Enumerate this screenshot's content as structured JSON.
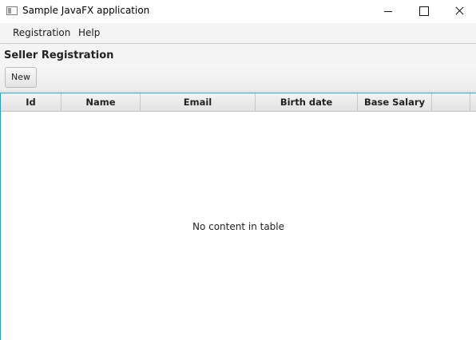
{
  "window": {
    "title": "Sample JavaFX application",
    "icon": "app-window-icon"
  },
  "menubar": {
    "items": [
      {
        "label": "Registration"
      },
      {
        "label": "Help"
      }
    ]
  },
  "section": {
    "title": "Seller Registration"
  },
  "toolbar": {
    "new_label": "New"
  },
  "table": {
    "columns": [
      "Id",
      "Name",
      "Email",
      "Birth date",
      "Base Salary",
      "",
      ""
    ],
    "rows": [],
    "placeholder": "No content in table"
  },
  "colors": {
    "focus_border": "#1fa2d4",
    "background": "#f4f4f4"
  }
}
